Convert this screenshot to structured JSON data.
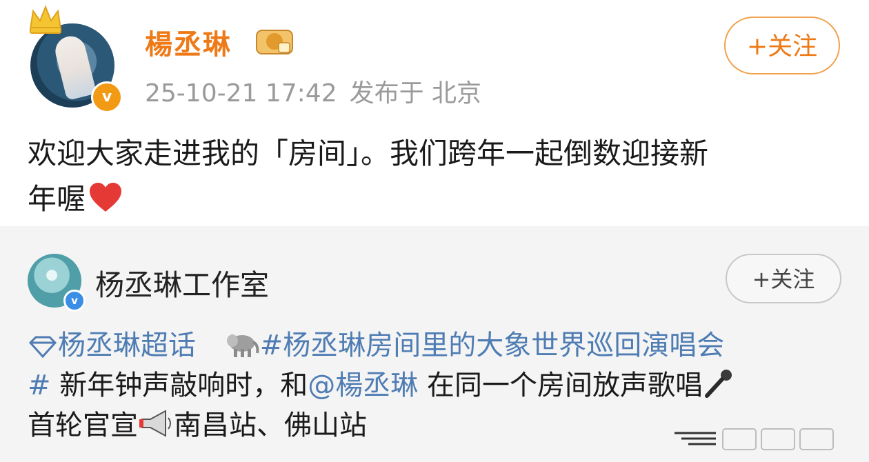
{
  "post": {
    "author": "楊丞琳",
    "meta": {
      "time": "25-10-21 17:42",
      "location": "发布于 北京"
    },
    "follow_label": "+关注",
    "text_line1": "欢迎大家走进我的「房间」。我们跨年一起倒数迎接新",
    "text_line2": "年喔",
    "heart_emoji": "heart-icon"
  },
  "repost": {
    "author": "杨丞琳工作室",
    "follow_label": "+关注",
    "line1": {
      "topic1": "杨丞琳超话",
      "topic2": "#杨丞琳房间里的大象世界巡回演唱会"
    },
    "line2": {
      "hash": "#",
      "text": " 新年钟声敲响时，和",
      "mention": "@楊丞琳",
      "text2": " 在同一个房间放声歌唱"
    },
    "line3": {
      "text": "首轮官宣",
      "text2": "南昌站、佛山站"
    }
  },
  "colors": {
    "accent": "#ee7a17",
    "topic": "#4f7db3",
    "repost_bg": "#f4f4f4"
  }
}
